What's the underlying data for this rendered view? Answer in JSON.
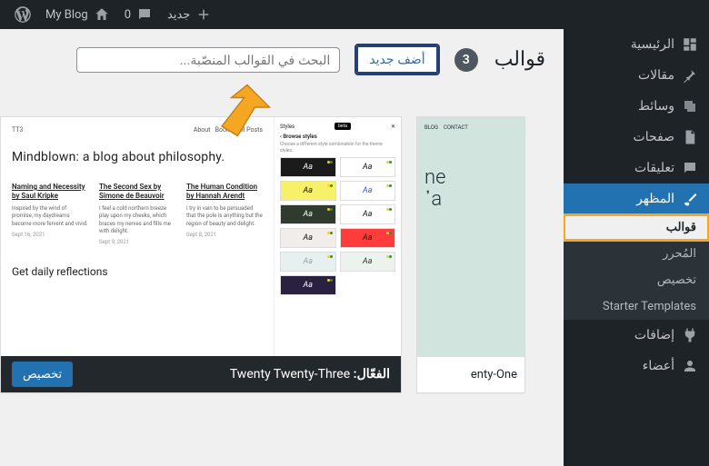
{
  "adminbar": {
    "site_title": "My Blog",
    "comments_count": "0",
    "new_label": "جديد"
  },
  "sidebar": {
    "items": [
      {
        "label": "الرئيسية"
      },
      {
        "label": "مقالات"
      },
      {
        "label": "وسائط"
      },
      {
        "label": "صفحات"
      },
      {
        "label": "تعليقات"
      },
      {
        "label": "المظهر"
      },
      {
        "label": "إضافات"
      },
      {
        "label": "أعضاء"
      }
    ],
    "appearance_sub": [
      {
        "label": "قوالب"
      },
      {
        "label": "المُحرر"
      },
      {
        "label": "تخصيص"
      },
      {
        "label": "Starter Templates"
      }
    ]
  },
  "header": {
    "title": "قوالب",
    "count": "3",
    "add_new": "أضف جديد",
    "search_placeholder": "البحث في القوالب المنصّبة..."
  },
  "themes": {
    "active": {
      "footer_prefix": "الفعّال:",
      "name": "Twenty Twenty-Three",
      "customize": "تخصيص",
      "preview": {
        "brand": "TT3",
        "nav": [
          "About",
          "Books",
          "All Posts"
        ],
        "headline": "Mindblown: a blog about philosophy.",
        "posts": [
          {
            "t": "Naming and Necessity by Saul Kripke",
            "b": "Inspired by the wind of promise, my daydreams become more fervent and vivid.",
            "d": "Sept 16, 2021"
          },
          {
            "t": "The Second Sex by Simone de Beauvoir",
            "b": "I feel a cold northern breeze play upon my cheeks, which braces my nerves and fills me with delight.",
            "d": "Sept 9, 2021"
          },
          {
            "t": "The Human Condition by Hannah Arendt",
            "b": "I try in vain to be persuaded that the pole is anything but the region of beauty and delight.",
            "d": "Sept 8, 2021"
          }
        ],
        "cta": "Get daily reflections",
        "styles_label": "Styles",
        "beta": "beta",
        "browse": "Browse styles",
        "browse_desc": "Choose a different style combination for the theme styles.",
        "token": "Aa",
        "swatches": [
          {
            "bg": "#1b1b1b",
            "fg": "#ffffff"
          },
          {
            "bg": "#ffffff",
            "fg": "#111111"
          },
          {
            "bg": "#f7f069",
            "fg": "#111111"
          },
          {
            "bg": "#ffffff",
            "fg": "#2d55ff"
          },
          {
            "bg": "#2f3b2f",
            "fg": "#ffffff"
          },
          {
            "bg": "#ffffff",
            "fg": "#111111"
          },
          {
            "bg": "#f0edea",
            "fg": "#111111"
          },
          {
            "bg": "#ff3b3b",
            "fg": "#1b1b1b",
            "italic": true
          },
          {
            "bg": "#e6f1ef",
            "fg": "#8aa8a3"
          },
          {
            "bg": "#ecf3ee",
            "fg": "#29392e"
          },
          {
            "bg": "#2a2141",
            "fg": "#ffffff"
          }
        ]
      }
    },
    "partial": {
      "name": "enty-One",
      "nav": [
        "BLOG",
        "CONTACT"
      ],
      "hero_a": "ne",
      "hero_b": "᾽a"
    }
  }
}
